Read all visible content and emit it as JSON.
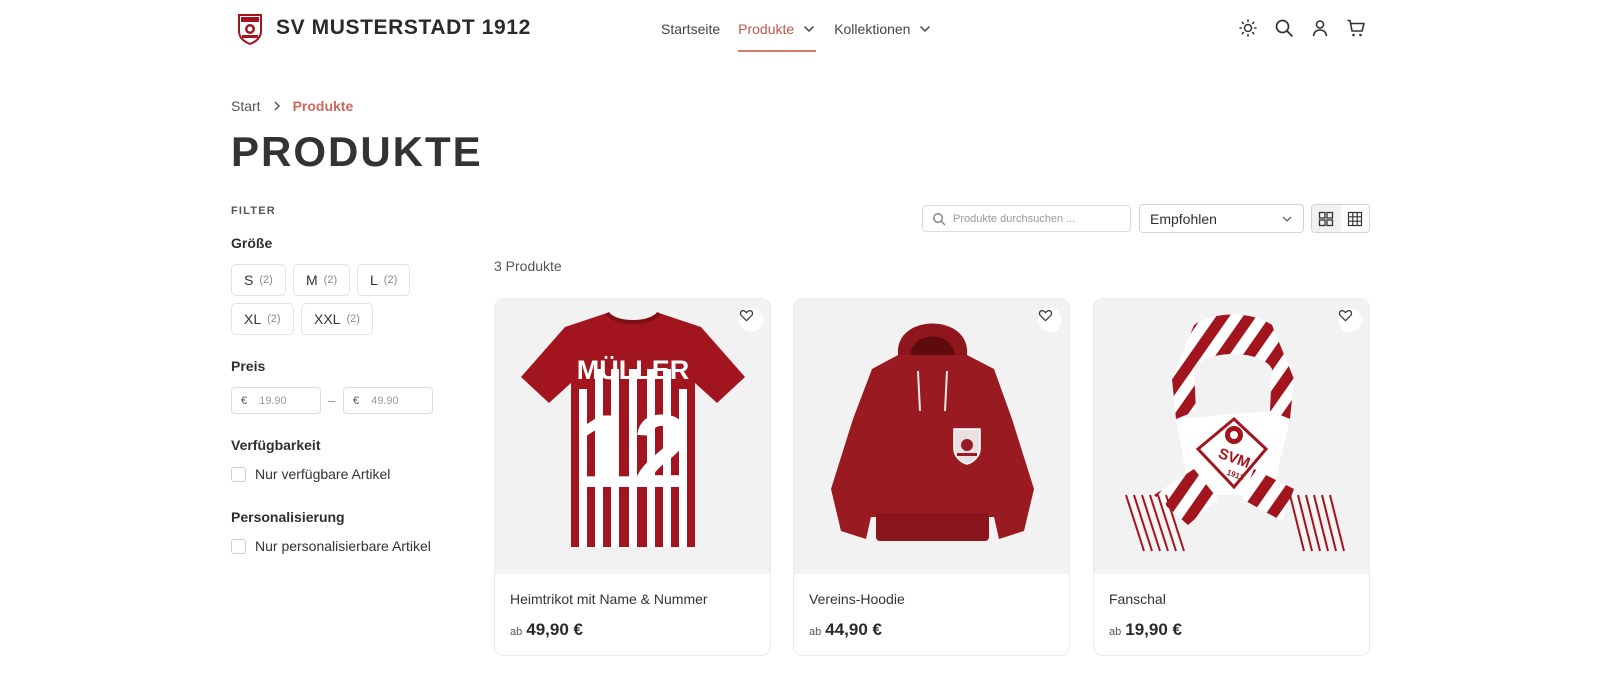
{
  "brand": {
    "name": "SV MUSTERSTADT 1912",
    "logo_text": "SVM",
    "accent": "#c0584a",
    "club_red": "#a3151e"
  },
  "nav": [
    {
      "label": "Startseite",
      "dropdown": false,
      "active": false
    },
    {
      "label": "Produkte",
      "dropdown": true,
      "active": true
    },
    {
      "label": "Kollektionen",
      "dropdown": true,
      "active": false
    }
  ],
  "header_icons": [
    "sun-icon",
    "search-icon",
    "user-icon",
    "cart-icon"
  ],
  "breadcrumb": {
    "start": "Start",
    "current": "Produkte"
  },
  "page_title": "PRODUKTE",
  "filter": {
    "heading": "FILTER",
    "size": {
      "title": "Größe",
      "options": [
        {
          "label": "S",
          "count": "(2)"
        },
        {
          "label": "M",
          "count": "(2)"
        },
        {
          "label": "L",
          "count": "(2)"
        },
        {
          "label": "XL",
          "count": "(2)"
        },
        {
          "label": "XXL",
          "count": "(2)"
        }
      ]
    },
    "price": {
      "title": "Preis",
      "currency": "€",
      "min_placeholder": "19.90",
      "max_placeholder": "49.90",
      "separator": "–"
    },
    "availability": {
      "title": "Verfügbarkeit",
      "option": "Nur verfügbare Artikel"
    },
    "personalization": {
      "title": "Personalisierung",
      "option": "Nur personalisierbare Artikel"
    }
  },
  "toolbar": {
    "search_placeholder": "Produkte durchsuchen ...",
    "sort_value": "Empfohlen",
    "views": [
      "grid-large-icon",
      "grid-small-icon"
    ]
  },
  "product_count": "3 Produkte",
  "products": [
    {
      "name": "Heimtrikot mit Name & Nummer",
      "price_prefix": "ab",
      "price": "49,90 €",
      "print_name": "MÜLLER",
      "print_number": "12"
    },
    {
      "name": "Vereins-Hoodie",
      "price_prefix": "ab",
      "price": "44,90 €"
    },
    {
      "name": "Fanschal",
      "price_prefix": "ab",
      "price": "19,90 €",
      "scarf_text": "SVM",
      "scarf_year": "1912"
    }
  ]
}
